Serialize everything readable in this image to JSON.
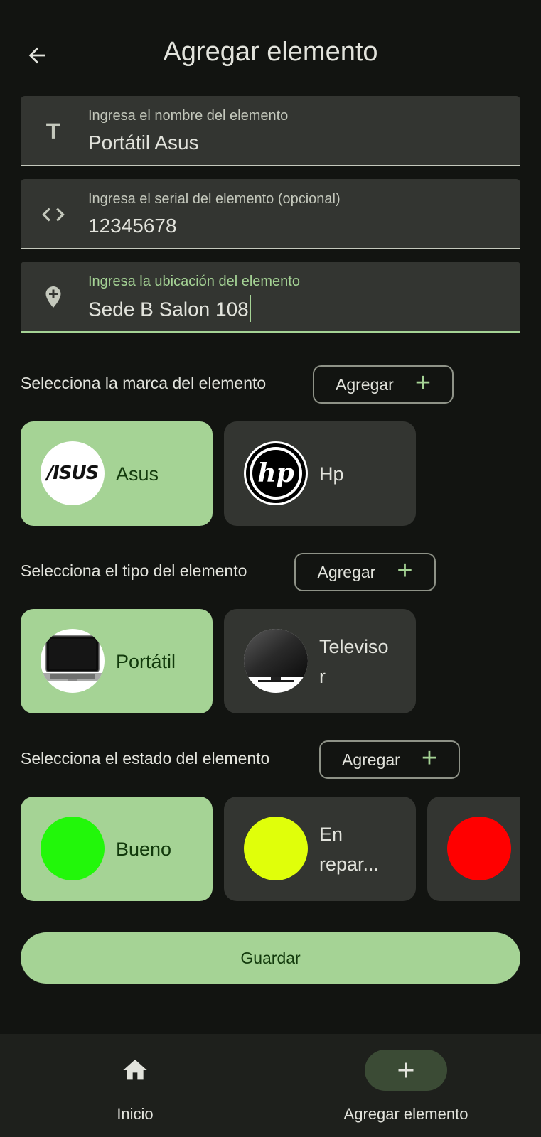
{
  "topbar": {
    "title": "Agregar elemento",
    "back_icon": "arrow-left-icon"
  },
  "fields": {
    "name": {
      "label": "Ingresa el nombre del elemento",
      "value": "Portátil Asus",
      "icon": "text-icon"
    },
    "serial": {
      "label": "Ingresa el serial del elemento (opcional)",
      "value": "12345678",
      "icon": "code-icon"
    },
    "location": {
      "label": "Ingresa la ubicación del elemento",
      "value": "Sede B Salon 108",
      "icon": "add-location-icon"
    }
  },
  "brand_section": {
    "label": "Selecciona la marca del elemento",
    "add_label": "Agregar",
    "items": [
      {
        "label": "Asus",
        "logo_text": "/ISUS",
        "selected": true
      },
      {
        "label": "Hp",
        "logo_text": "hp",
        "selected": false
      }
    ]
  },
  "type_section": {
    "label": "Selecciona el tipo del elemento",
    "add_label": "Agregar",
    "items": [
      {
        "label": "Portátil",
        "selected": true
      },
      {
        "label": "Televisor",
        "selected": false
      }
    ]
  },
  "state_section": {
    "label": "Selecciona el estado del elemento",
    "add_label": "Agregar",
    "items": [
      {
        "label": "Bueno",
        "color": "#22f70a",
        "selected": true
      },
      {
        "label": "En repar...",
        "color": "#e0ff0a",
        "selected": false
      },
      {
        "label": "",
        "color": "#ff0000",
        "selected": false
      }
    ]
  },
  "save_label": "Guardar",
  "bottom_nav": {
    "items": [
      {
        "label": "Inicio",
        "icon": "home-icon",
        "active": false
      },
      {
        "label": "Agregar elemento",
        "icon": "plus-icon",
        "active": true
      }
    ]
  },
  "colors": {
    "background": "#121411",
    "surface": "#333531",
    "accent": "#a5d395",
    "on_accent": "#123a0c"
  }
}
